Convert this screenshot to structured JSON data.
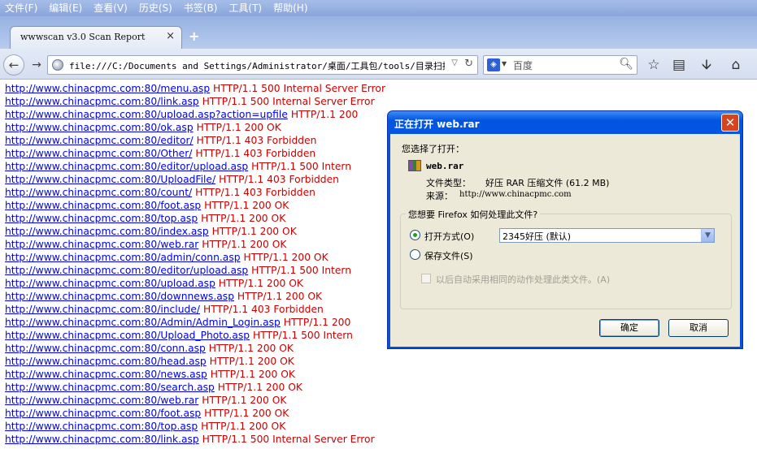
{
  "menu": [
    "文件(F)",
    "编辑(E)",
    "查看(V)",
    "历史(S)",
    "书签(B)",
    "工具(T)",
    "帮助(H)"
  ],
  "tab": {
    "title": "wwwscan v3.0 Scan Report",
    "close_icon": "×",
    "new_tab_icon": "+"
  },
  "nav": {
    "url": "file:///C:/Documents and Settings/Administrator/桌面/工具包/tools/目录扫描/[F",
    "search_placeholder": "百度",
    "icons": [
      "back-icon",
      "forward-icon",
      "site-icon",
      "dropdown-icon",
      "reload-icon",
      "search-icon",
      "bookmark-star-icon",
      "bookmarks-menu-icon",
      "download-icon",
      "home-icon"
    ]
  },
  "results": [
    {
      "url": "http://www.chinacpmc.com:80/menu.asp",
      "status": "HTTP/1.1 500 Internal Server Error"
    },
    {
      "url": "http://www.chinacpmc.com:80/link.asp",
      "status": "HTTP/1.1 500 Internal Server Error"
    },
    {
      "url": "http://www.chinacpmc.com:80/upload.asp?action=upfile",
      "status": "HTTP/1.1 200"
    },
    {
      "url": "http://www.chinacpmc.com:80/ok.asp",
      "status": "HTTP/1.1 200 OK"
    },
    {
      "url": "http://www.chinacpmc.com:80/editor/",
      "status": "HTTP/1.1 403 Forbidden"
    },
    {
      "url": "http://www.chinacpmc.com:80/Other/",
      "status": "HTTP/1.1 403 Forbidden"
    },
    {
      "url": "http://www.chinacpmc.com:80/editor/upload.asp",
      "status": "HTTP/1.1 500 Intern"
    },
    {
      "url": "http://www.chinacpmc.com:80/UploadFile/",
      "status": "HTTP/1.1 403 Forbidden"
    },
    {
      "url": "http://www.chinacpmc.com:80/count/",
      "status": "HTTP/1.1 403 Forbidden"
    },
    {
      "url": "http://www.chinacpmc.com:80/foot.asp",
      "status": "HTTP/1.1 200 OK"
    },
    {
      "url": "http://www.chinacpmc.com:80/top.asp",
      "status": "HTTP/1.1 200 OK"
    },
    {
      "url": "http://www.chinacpmc.com:80/index.asp",
      "status": "HTTP/1.1 200 OK"
    },
    {
      "url": "http://www.chinacpmc.com:80/web.rar",
      "status": "HTTP/1.1 200 OK"
    },
    {
      "url": "http://www.chinacpmc.com:80/admin/conn.asp",
      "status": "HTTP/1.1 200 OK"
    },
    {
      "url": "http://www.chinacpmc.com:80/editor/upload.asp",
      "status": "HTTP/1.1 500 Intern"
    },
    {
      "url": "http://www.chinacpmc.com:80/upload.asp",
      "status": "HTTP/1.1 200 OK"
    },
    {
      "url": "http://www.chinacpmc.com:80/downnews.asp",
      "status": "HTTP/1.1 200 OK"
    },
    {
      "url": "http://www.chinacpmc.com:80/include/",
      "status": "HTTP/1.1 403 Forbidden"
    },
    {
      "url": "http://www.chinacpmc.com:80/Admin/Admin_Login.asp",
      "status": "HTTP/1.1 200"
    },
    {
      "url": "http://www.chinacpmc.com:80/Upload_Photo.asp",
      "status": "HTTP/1.1 500 Intern"
    },
    {
      "url": "http://www.chinacpmc.com:80/conn.asp",
      "status": "HTTP/1.1 200 OK"
    },
    {
      "url": "http://www.chinacpmc.com:80/head.asp",
      "status": "HTTP/1.1 200 OK"
    },
    {
      "url": "http://www.chinacpmc.com:80/news.asp",
      "status": "HTTP/1.1 200 OK"
    },
    {
      "url": "http://www.chinacpmc.com:80/search.asp",
      "status": "HTTP/1.1 200 OK"
    },
    {
      "url": "http://www.chinacpmc.com:80/web.rar",
      "status": "HTTP/1.1 200 OK"
    },
    {
      "url": "http://www.chinacpmc.com:80/foot.asp",
      "status": "HTTP/1.1 200 OK"
    },
    {
      "url": "http://www.chinacpmc.com:80/top.asp",
      "status": "HTTP/1.1 200 OK"
    },
    {
      "url": "http://www.chinacpmc.com:80/link.asp",
      "status": "HTTP/1.1 500 Internal Server Error"
    }
  ],
  "dialog": {
    "title": "正在打开 web.rar",
    "chosen_label": "您选择了打开：",
    "file_name": "web.rar",
    "file_type_label": "文件类型：",
    "file_type_value": "好压 RAR 压缩文件 (61.2 MB)",
    "source_label": "来源：",
    "source_value": "http://www.chinacpmc.com",
    "action_legend": "您想要 Firefox 如何处理此文件?",
    "open_with_label": "打开方式(O)",
    "open_with_app": "2345好压 (默认)",
    "save_label": "保存文件(S)",
    "remember_label": "以后自动采用相同的动作处理此类文件。(A)",
    "ok_label": "确定",
    "cancel_label": "取消",
    "close_icon": "✕"
  },
  "colors": {
    "link": "#0000ee",
    "status": "#cc0000",
    "dialog_title_bg": "#0454e3",
    "dialog_body_bg": "#ece9d8"
  }
}
